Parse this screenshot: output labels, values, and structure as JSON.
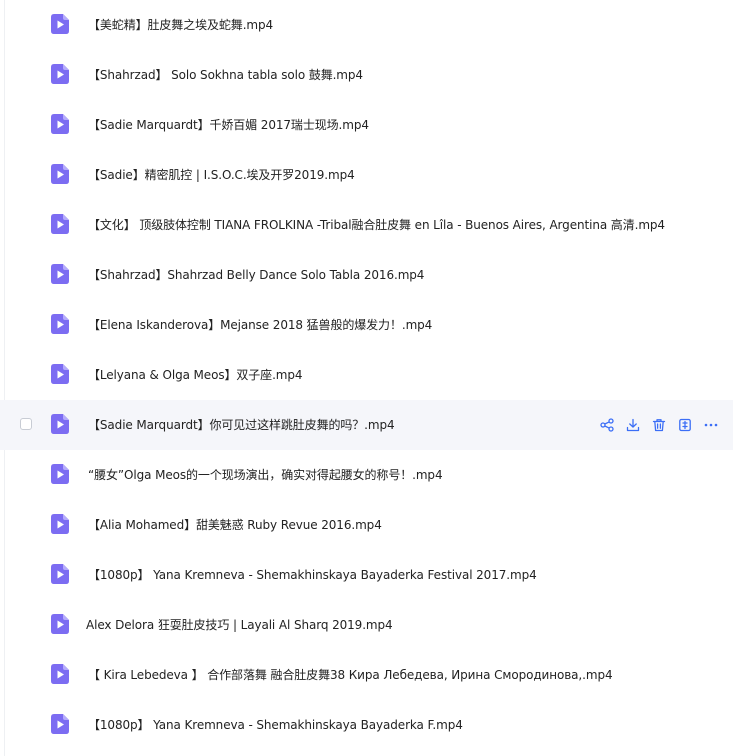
{
  "files": [
    {
      "name": "【美蛇精】肚皮舞之埃及蛇舞.mp4",
      "icon": "video-file-icon"
    },
    {
      "name": "【Shahrzad】 Solo Sokhna tabla solo 鼓舞.mp4",
      "icon": "video-file-icon"
    },
    {
      "name": "【Sadie Marquardt】千娇百媚 2017瑞士现场.mp4",
      "icon": "video-file-icon"
    },
    {
      "name": "【Sadie】精密肌控 | I.S.O.C.埃及开罗2019.mp4",
      "icon": "video-file-icon"
    },
    {
      "name": "【文化】 顶级肢体控制 TIANA FROLKINA -Tribal融合肚皮舞 en Lîla - Buenos Aires, Argentina 高清.mp4",
      "icon": "video-file-icon"
    },
    {
      "name": "【Shahrzad】Shahrzad Belly Dance Solo Tabla 2016.mp4",
      "icon": "video-file-icon"
    },
    {
      "name": "【Elena Iskanderova】Mejanse 2018 猛兽般的爆发力！.mp4",
      "icon": "video-file-icon"
    },
    {
      "name": "【Lelyana & Olga Meos】双子座.mp4",
      "icon": "video-file-icon"
    },
    {
      "name": "【Sadie Marquardt】你可见过这样跳肚皮舞的吗？.mp4",
      "icon": "video-file-icon"
    },
    {
      "name": "“腰女”Olga Meos的一个现场演出，确实对得起腰女的称号！.mp4",
      "icon": "video-file-icon"
    },
    {
      "name": "【Alia Mohamed】甜美魅惑 Ruby Revue 2016.mp4",
      "icon": "video-file-icon"
    },
    {
      "name": "【1080p】 Yana Kremneva - Shemakhinskaya Bayaderka Festival 2017.mp4",
      "icon": "video-file-icon"
    },
    {
      "name": "Alex Delora 狂耍肚皮技巧 | Layali Al Sharq 2019.mp4",
      "icon": "video-file-icon"
    },
    {
      "name": "【 Kira Lebedeva 】 合作部落舞 融合肚皮舞38 Кира Лебедева, Ирина Смородинова,.mp4",
      "icon": "video-file-icon"
    },
    {
      "name": "【1080p】 Yana Kremneva - Shemakhinskaya Bayaderka F.mp4",
      "icon": "video-file-icon"
    }
  ],
  "hovered_row_index": 8,
  "row_actions": [
    {
      "name": "share-icon"
    },
    {
      "name": "download-icon"
    },
    {
      "name": "delete-icon"
    },
    {
      "name": "extract-icon"
    },
    {
      "name": "more-icon"
    }
  ],
  "colors": {
    "icon_purple": "#7c6cf2",
    "icon_purple_light": "#b5acfa",
    "action_blue": "#3b6ef6",
    "hover_bg": "#f5f6fa"
  }
}
